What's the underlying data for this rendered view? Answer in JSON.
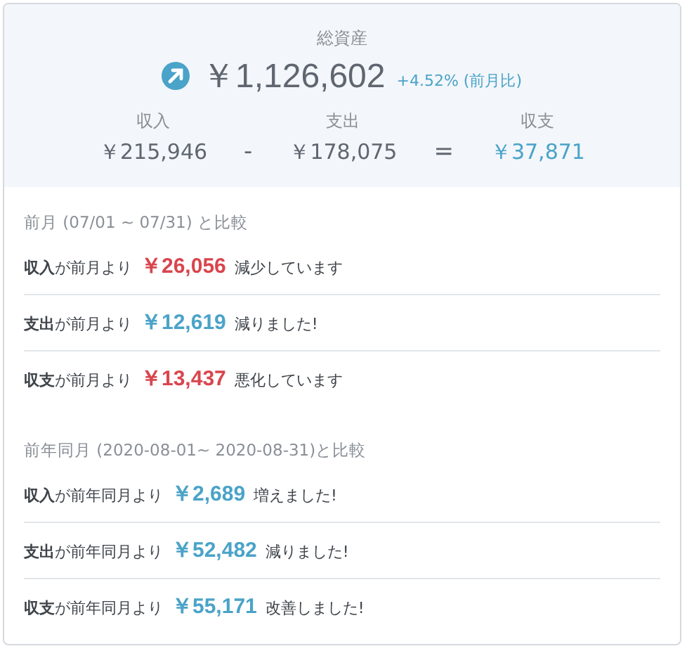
{
  "summary": {
    "title": "総資産",
    "total": "￥1,126,602",
    "rising": true,
    "change": "+4.52% (前月比)",
    "breakdown": [
      {
        "label": "収入",
        "value": "￥215,946",
        "highlight": false
      },
      {
        "operator": "-"
      },
      {
        "label": "支出",
        "value": "￥178,075",
        "highlight": false
      },
      {
        "operator": "="
      },
      {
        "label": "収支",
        "value": "￥37,871",
        "highlight": true
      }
    ]
  },
  "comparisons": [
    {
      "heading": "前月 (07/01 ~ 07/31) と比較",
      "rows": [
        {
          "lead": "**収入**が前月より",
          "amount": "￥26,056",
          "color": "#d9454d",
          "result": "減少しています"
        },
        {
          "lead": "**支出**が前月より",
          "amount": "￥12,619",
          "color": "#4aa3c8",
          "result": "減りました!"
        },
        {
          "lead": "**収支**が前月より",
          "amount": "￥13,437",
          "color": "#d9454d",
          "result": "悪化しています"
        }
      ]
    },
    {
      "heading": "前年同月 (2020-08-01~ 2020-08-31)と比較",
      "rows": [
        {
          "lead": "**収入**が前年同月より",
          "amount": "￥2,689",
          "color": "#4aa3c8",
          "result": "増えました!"
        },
        {
          "lead": "**支出**が前年同月より",
          "amount": "￥52,482",
          "color": "#4aa3c8",
          "result": "減りました!"
        },
        {
          "lead": "**収支**が前年同月より",
          "amount": "￥55,171",
          "color": "#4aa3c8",
          "result": "改善しました!"
        }
      ]
    }
  ]
}
